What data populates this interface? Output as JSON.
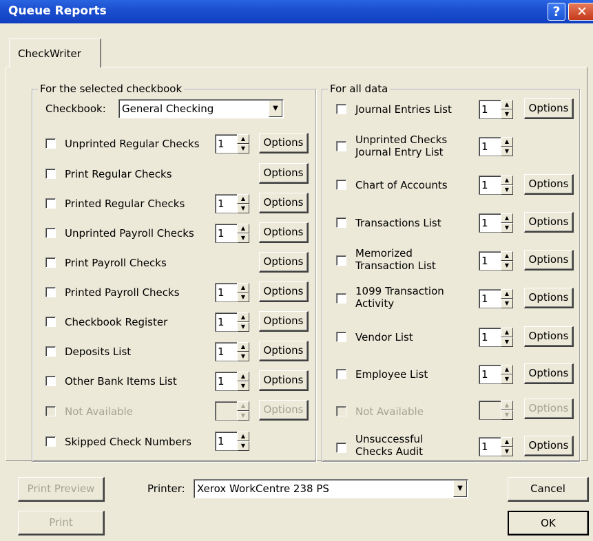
{
  "window": {
    "title": "Queue Reports",
    "help_glyph": "?",
    "close_glyph": "✕"
  },
  "tabs": [
    {
      "label": "CheckWriter"
    }
  ],
  "left_group": {
    "title": "For the selected checkbook",
    "checkbook_label": "Checkbook:",
    "checkbook_value": "General Checking",
    "rows": [
      {
        "label": "Unprinted Regular Checks",
        "copies": "1",
        "options": "Options"
      },
      {
        "label": "Print Regular Checks",
        "options": "Options"
      },
      {
        "label": "Printed Regular Checks",
        "copies": "1",
        "options": "Options"
      },
      {
        "label": "Unprinted Payroll Checks",
        "copies": "1",
        "options": "Options"
      },
      {
        "label": "Print Payroll Checks",
        "options": "Options"
      },
      {
        "label": "Printed Payroll Checks",
        "copies": "1",
        "options": "Options"
      },
      {
        "label": "Checkbook Register",
        "copies": "1",
        "options": "Options"
      },
      {
        "label": "Deposits List",
        "copies": "1",
        "options": "Options"
      },
      {
        "label": "Other Bank Items List",
        "copies": "1",
        "options": "Options"
      },
      {
        "label": "Not Available",
        "copies": "",
        "options": "Options"
      },
      {
        "label": "Skipped Check Numbers",
        "copies": "1"
      }
    ]
  },
  "right_group": {
    "title": "For all data",
    "rows": [
      {
        "label": "Journal Entries List",
        "copies": "1",
        "options": "Options"
      },
      {
        "label": "Unprinted Checks Journal Entry List",
        "copies": "1"
      },
      {
        "label": "Chart of Accounts",
        "copies": "1",
        "options": "Options"
      },
      {
        "label": "Transactions List",
        "copies": "1",
        "options": "Options"
      },
      {
        "label": "Memorized Transaction List",
        "copies": "1",
        "options": "Options"
      },
      {
        "label": "1099 Transaction Activity",
        "copies": "1",
        "options": "Options"
      },
      {
        "label": "Vendor List",
        "copies": "1",
        "options": "Options"
      },
      {
        "label": "Employee List",
        "copies": "1",
        "options": "Options"
      },
      {
        "label": "Not Available",
        "copies": "",
        "options": "Options"
      },
      {
        "label": "Unsuccessful Checks Audit",
        "copies": "1",
        "options": "Options"
      }
    ]
  },
  "footer": {
    "print_preview": "Print Preview",
    "print": "Print",
    "printer_label": "Printer:",
    "printer_value": "Xerox WorkCentre 238 PS",
    "cancel": "Cancel",
    "ok": "OK"
  }
}
